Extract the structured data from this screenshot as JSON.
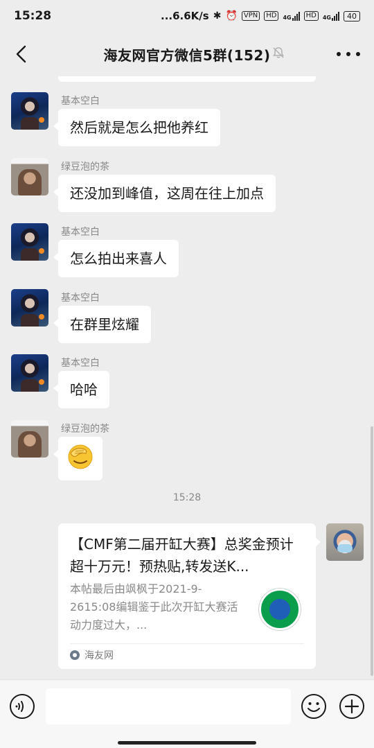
{
  "status_bar": {
    "time": "15:28",
    "speed": "...6.6K/s",
    "vpn": "VPN",
    "hd1": "HD",
    "hd2": "HD",
    "net1": "4G",
    "net2": "4G",
    "battery": "40"
  },
  "header": {
    "title": "海友网官方微信5群(152)"
  },
  "messages": [
    {
      "sender": "基本空白",
      "text": "然后就是怎么把他养红"
    },
    {
      "sender": "绿豆泡的茶",
      "text": "还没加到峰值，这周在往上加点"
    },
    {
      "sender": "基本空白",
      "text": "怎么拍出来喜人"
    },
    {
      "sender": "基本空白",
      "text": "在群里炫耀"
    },
    {
      "sender": "基本空白",
      "text": "哈哈"
    },
    {
      "sender": "绿豆泡的茶",
      "text": ""
    }
  ],
  "timestamp": "15:28",
  "link_card": {
    "title": "【CMF第二届开缸大赛】总奖金预计超十万元！预热贴,转发送K...",
    "description": "本帖最后由飒枫于2021-9-2615:08编辑鉴于此次开缸大赛活动力度过大，...",
    "source": "海友网"
  }
}
